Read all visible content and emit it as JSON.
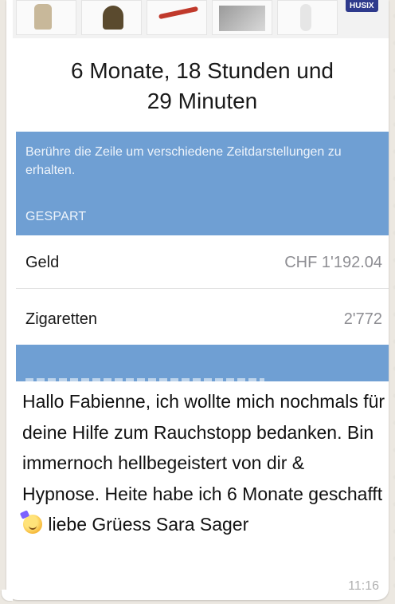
{
  "screenshot": {
    "thumbnails": [
      {
        "name": "backpack-thumbnail-icon"
      },
      {
        "name": "cupcake-thumbnail-icon"
      },
      {
        "name": "tool-thumbnail-icon"
      },
      {
        "name": "landscape-thumbnail-icon"
      },
      {
        "name": "bottle-thumbnail-icon"
      }
    ],
    "badge_text": "HUSIX",
    "duration_line1": "6 Monate, 18 Stunden und",
    "duration_line2": "29 Minuten",
    "hint": "Berühre die Zeile um verschiedene Zeitdarstellungen zu erhalten.",
    "section_label": "GESPART",
    "rows": [
      {
        "label": "Geld",
        "value": "CHF 1'192.04"
      },
      {
        "label": "Zigaretten",
        "value": "2'772"
      }
    ]
  },
  "message": {
    "part1": "Hallo Fabienne, ich wollte mich nochmals für deine Hilfe zum Rauchstopp bedanken. Bin immernoch hellbegeistert von dir & Hypnose. Heite habe ich 6 Monate geschafft",
    "emoji_name": "partying-face-emoji-icon",
    "part2": " liebe Grüess Sara Sager",
    "time": "11:16"
  },
  "colors": {
    "panel_blue": "#6f9fd3",
    "bubble": "#ffffff",
    "background": "#ece8e1"
  }
}
